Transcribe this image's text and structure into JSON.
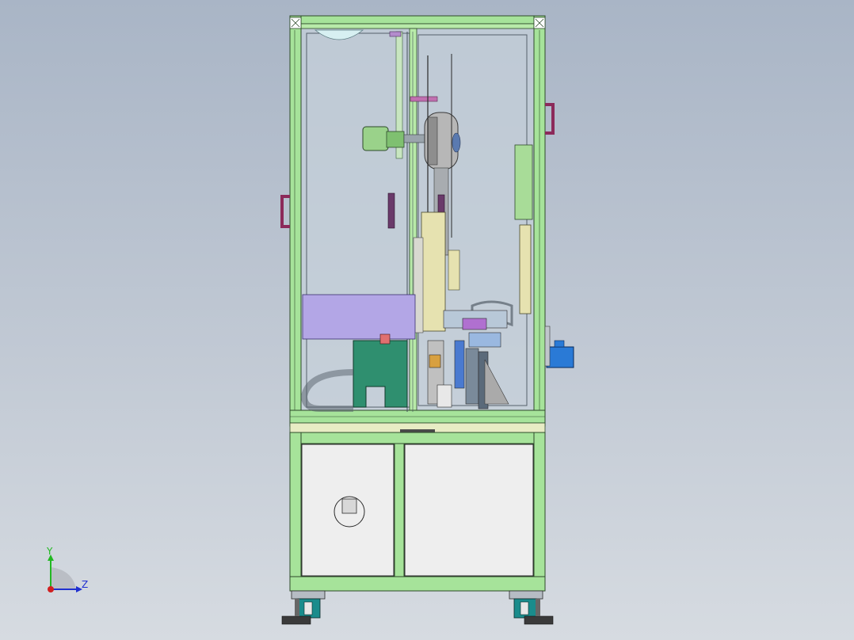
{
  "viewport": {
    "background_top": "#a9b5c6",
    "background_bottom": "#d6dbe1"
  },
  "model": {
    "frame_color": "#a6e39a",
    "frame_edge_color": "#2d4a2a",
    "glass_color": "#c9d3dc",
    "cabinet_door_color": "#eeeeee",
    "caster_wheel_color": "#1a8c8c",
    "handle_color": "#8c2a5a",
    "motor_color": "#9ad28a",
    "reel_color": "#b7b7b7",
    "rail_color": "#e6e2b0",
    "feeder_plate_color": "#b3a6e6",
    "bracket_color": "#2f8f6f",
    "pneumatic_box_color": "#2a7ad6"
  },
  "triad": {
    "x_axis_color": "#d12020",
    "y_axis_color": "#22b822",
    "z_axis_color": "#2030d0",
    "y_label": "Y",
    "z_label": "Z"
  }
}
